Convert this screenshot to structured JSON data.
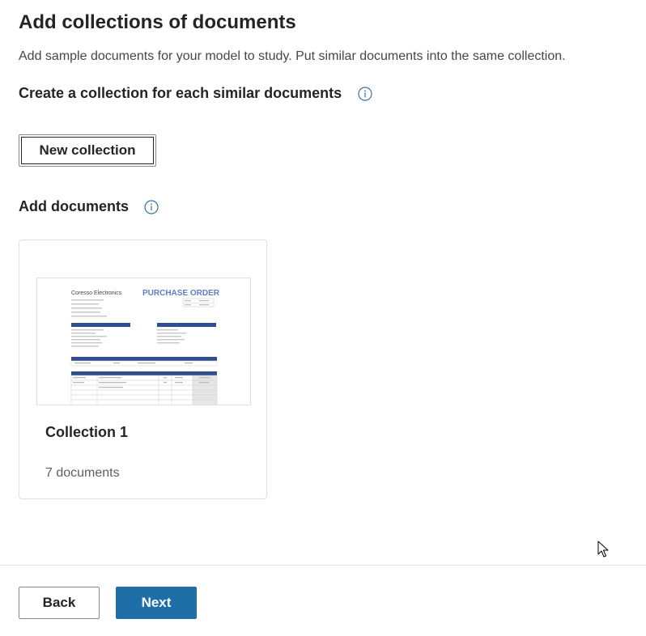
{
  "header": {
    "title": "Add collections of documents",
    "subtitle": "Add sample documents for your model to study. Put similar documents into the same collection."
  },
  "collections_section": {
    "heading": "Create a collection for each similar documents",
    "info_icon": "info-icon",
    "new_collection_label": "New collection"
  },
  "documents_section": {
    "heading": "Add documents",
    "info_icon": "info-icon",
    "cards": [
      {
        "title": "Collection 1",
        "count_label": "7 documents",
        "thumbnail": {
          "company": "Coresso Electronics",
          "doc_title": "PURCHASE ORDER"
        }
      }
    ]
  },
  "footer": {
    "back_label": "Back",
    "next_label": "Next"
  },
  "colors": {
    "accent": "#1e6ea8",
    "info_icon": "#3a6fa8",
    "text": "#252423",
    "muted": "#605e5c",
    "border": "#e1dfdd"
  }
}
